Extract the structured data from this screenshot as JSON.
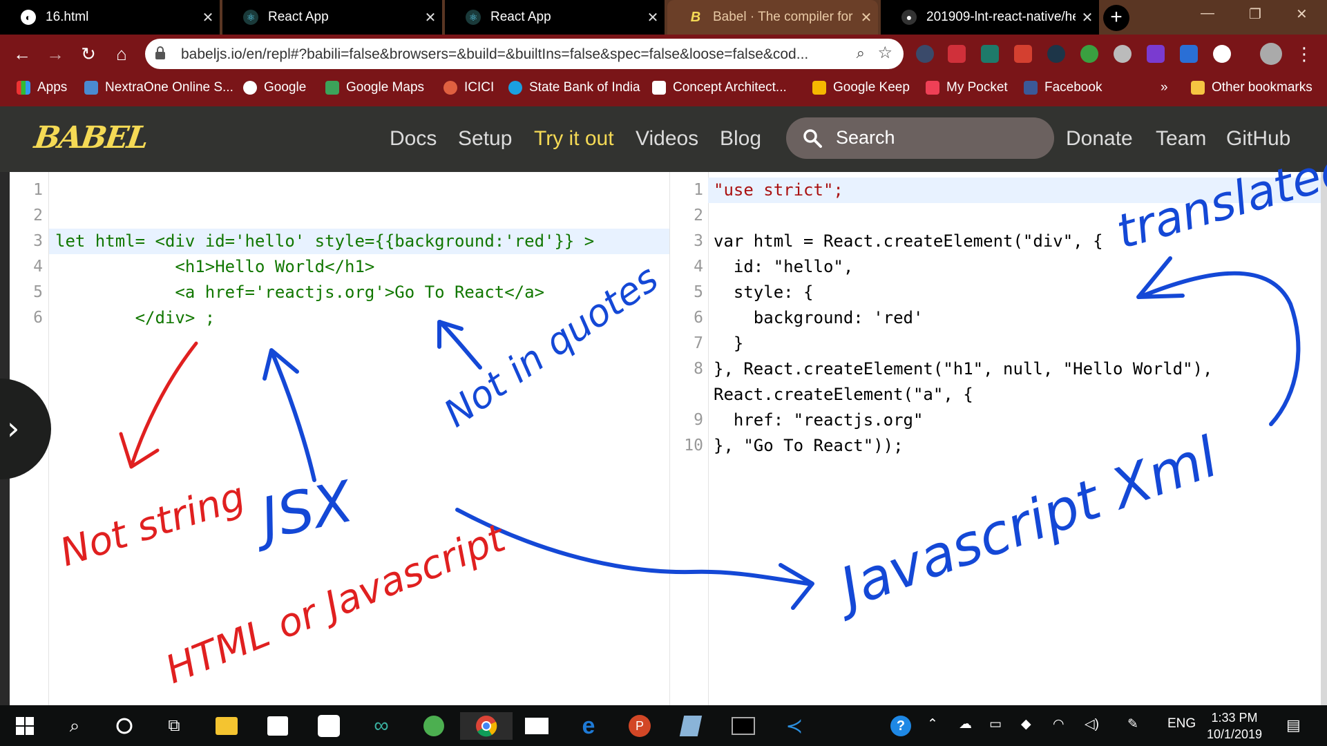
{
  "browser": {
    "tabs": [
      {
        "title": "16.html",
        "active": false
      },
      {
        "title": "React App",
        "active": false
      },
      {
        "title": "React App",
        "active": false
      },
      {
        "title": "Babel · The compiler for ne",
        "active": true
      },
      {
        "title": "201909-lnt-react-native/he",
        "active": false
      }
    ],
    "url": "babeljs.io/en/repl#?babili=false&browsers=&build=&builtIns=false&spec=false&loose=false&cod...",
    "bookmarks": [
      {
        "label": "Apps",
        "icon": "apps-grid-icon"
      },
      {
        "label": "NextraOne Online S...",
        "icon": "nextraone-icon"
      },
      {
        "label": "Google",
        "icon": "google-icon"
      },
      {
        "label": "Google Maps",
        "icon": "google-maps-icon"
      },
      {
        "label": "ICICI",
        "icon": "icici-icon"
      },
      {
        "label": "State Bank of India",
        "icon": "sbi-icon"
      },
      {
        "label": "Concept Architect...",
        "icon": "gmail-icon"
      },
      {
        "label": "Google Keep",
        "icon": "google-keep-icon"
      },
      {
        "label": "My Pocket",
        "icon": "pocket-icon"
      },
      {
        "label": "Facebook",
        "icon": "facebook-icon"
      }
    ],
    "overflow": "»",
    "other_bookmarks": "Other bookmarks"
  },
  "site": {
    "logo": "BABEL",
    "nav": [
      {
        "label": "Docs",
        "active": false
      },
      {
        "label": "Setup",
        "active": false
      },
      {
        "label": "Try it out",
        "active": true
      },
      {
        "label": "Videos",
        "active": false
      },
      {
        "label": "Blog",
        "active": false
      }
    ],
    "search_placeholder": "Search",
    "nav_right": [
      {
        "label": "Donate"
      },
      {
        "label": "Team"
      },
      {
        "label": "GitHub"
      }
    ]
  },
  "editor_input": {
    "line_numbers": [
      "1",
      "2",
      "3",
      "4",
      "5",
      "6"
    ],
    "lines": [
      "",
      "",
      "let html= <div id='hello' style={{background:'red'}} >",
      "            <h1>Hello World</h1>",
      "            <a href='reactjs.org'>Go To React</a>",
      "        </div> ;"
    ]
  },
  "editor_output": {
    "line_numbers": [
      "1",
      "2",
      "3",
      "4",
      "5",
      "6",
      "7",
      "8",
      "",
      "9",
      "10"
    ],
    "lines": [
      "\"use strict\";",
      "",
      "var html = React.createElement(\"div\", {",
      "  id: \"hello\",",
      "  style: {",
      "    background: 'red'",
      "  }",
      "}, React.createElement(\"h1\", null, \"Hello World\"),",
      "React.createElement(\"a\", {",
      "  href: \"reactjs.org\"",
      "}, \"Go To React\"));"
    ]
  },
  "annotations": {
    "not_string": "Not string",
    "html_or_javascript": "HTML or Javascript",
    "jsx": "JSX",
    "not_in_quotes": "Not in quotes",
    "translated": "translated",
    "javascript_xml": "Javascript Xml"
  },
  "taskbar": {
    "language": "ENG",
    "time": "1:33 PM",
    "date": "10/1/2019"
  },
  "colors": {
    "titlebar": "#5a3623",
    "toolbar": "#7a1518",
    "babel_nav": "#323330",
    "babel_accent": "#f5da55",
    "ink_red": "#e02020",
    "ink_blue": "#1448d6"
  }
}
